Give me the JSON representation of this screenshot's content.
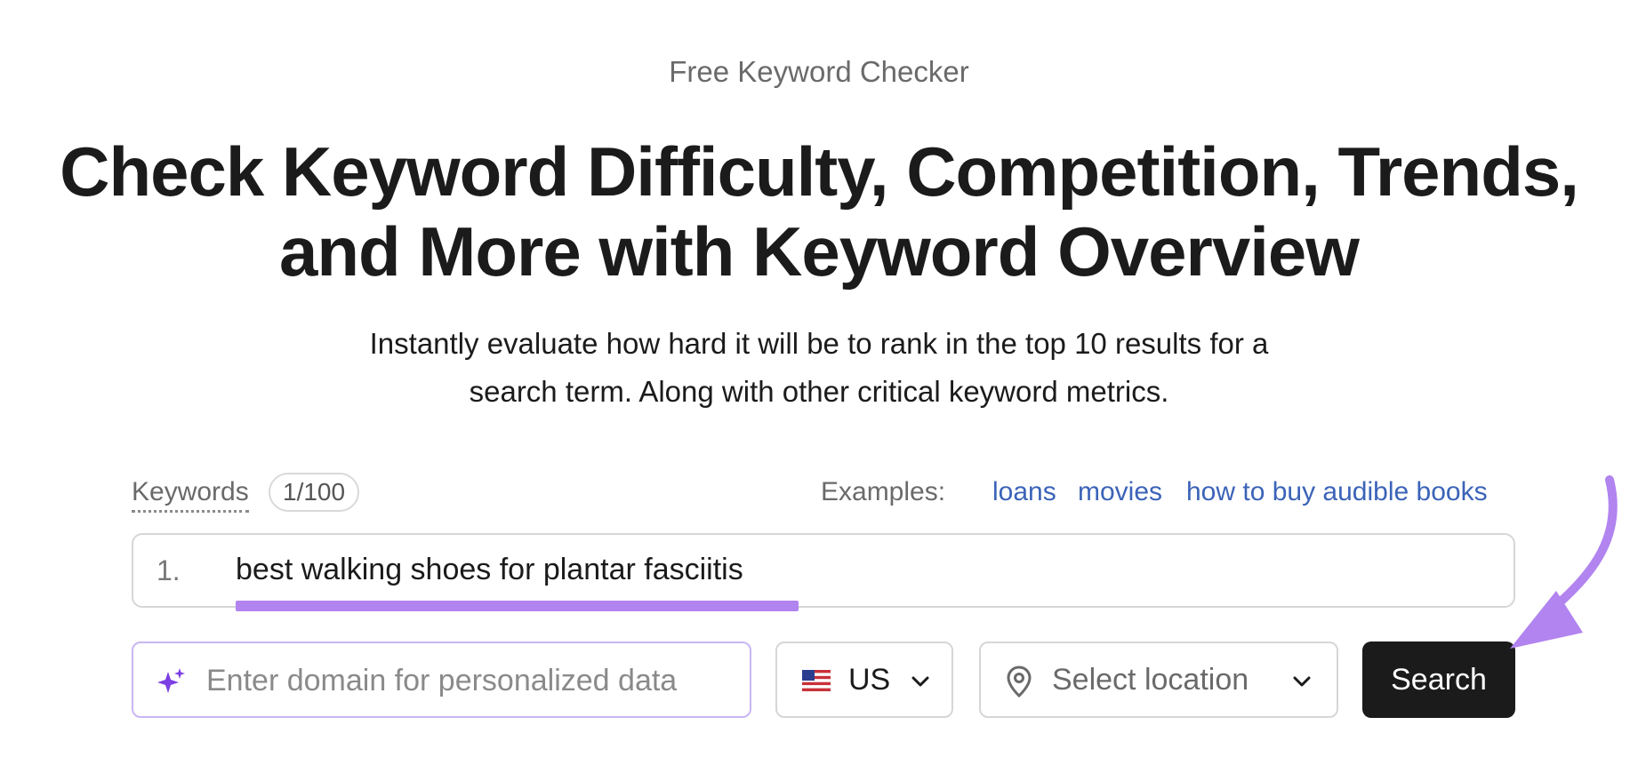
{
  "header": {
    "eyebrow": "Free Keyword Checker",
    "title_line1": "Check Keyword Difficulty, Competition, Trends,",
    "title_line2": "and More with Keyword Overview",
    "subtitle_line1": "Instantly evaluate how hard it will be to rank in the top 10 results for a",
    "subtitle_line2": "search term. Along with other critical keyword metrics."
  },
  "keywords": {
    "label": "Keywords",
    "counter": "1/100",
    "examples_label": "Examples:",
    "examples": [
      "loans",
      "movies",
      "how to buy audible books"
    ],
    "entries": [
      {
        "number": "1.",
        "text": "best walking shoes for plantar fasciitis"
      }
    ]
  },
  "controls": {
    "domain_placeholder": "Enter domain for personalized data",
    "country_code": "US",
    "location_label": "Select location",
    "search_label": "Search"
  },
  "colors": {
    "accent_purple": "#b184f0",
    "link_blue": "#3b63b8",
    "button_dark": "#1b1b1b"
  },
  "icons": {
    "domain": "sparkle-icon",
    "country": "us-flag-icon",
    "location": "map-pin-icon",
    "dropdown": "chevron-down-icon",
    "annotation": "curved-arrow-icon"
  }
}
